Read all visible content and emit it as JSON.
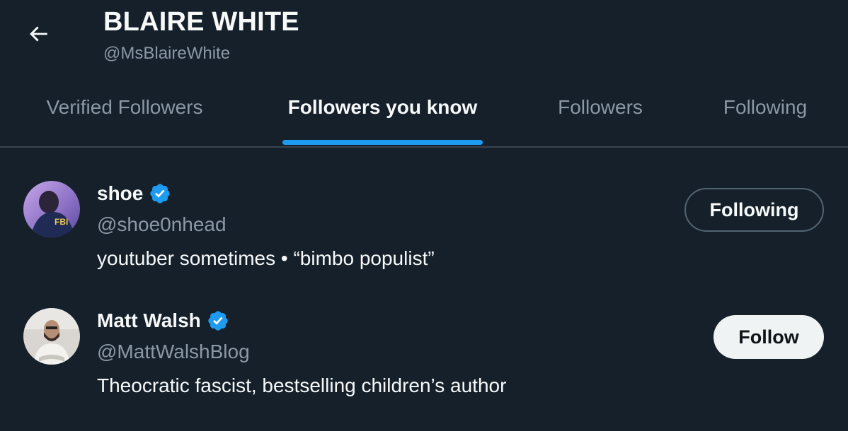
{
  "header": {
    "title": "BLAIRE WHITE",
    "handle": "@MsBlaireWhite"
  },
  "tabs": [
    {
      "label": "Verified Followers",
      "active": false
    },
    {
      "label": "Followers you know",
      "active": true
    },
    {
      "label": "Followers",
      "active": false
    },
    {
      "label": "Following",
      "active": false
    }
  ],
  "users": [
    {
      "name": "shoe",
      "verified": true,
      "handle": "@shoe0nhead",
      "bio": "youtuber sometimes • “bimbo populist”",
      "button_label": "Following"
    },
    {
      "name": "Matt Walsh",
      "verified": true,
      "handle": "@MattWalshBlog",
      "bio": "Theocratic fascist, bestselling children’s author",
      "button_label": "Follow"
    }
  ],
  "icons": {
    "back": "back-arrow-icon",
    "verified": "verified-badge-icon"
  },
  "colors": {
    "background": "#15202b",
    "accent": "#1d9bf0",
    "secondary_text": "#8b98a5",
    "primary_text": "#f7f9f9",
    "follow_button_bg": "#eff3f4"
  }
}
